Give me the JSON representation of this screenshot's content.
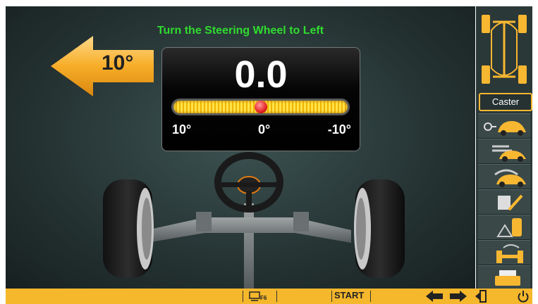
{
  "instruction": "Turn the Steering Wheel to Left",
  "reading": "0.0",
  "gauge": {
    "level": 0.5,
    "left_label": "10°",
    "center_label": "0°",
    "right_label": "-10°"
  },
  "direction_arrow": {
    "direction": "left",
    "label": "10°"
  },
  "sidebar": {
    "mode_label": "Caster",
    "buttons": [
      "adjust-icon",
      "swap-icon",
      "speed-icon",
      "wrench-icon",
      "gauge-icon",
      "axle-icon",
      "printer-icon"
    ]
  },
  "bottom_bar": {
    "start_label": "START",
    "f6_label": "F6"
  },
  "colors": {
    "accent": "#f5b72c",
    "instruction": "#2fdc2f",
    "marker": "#e42424"
  }
}
